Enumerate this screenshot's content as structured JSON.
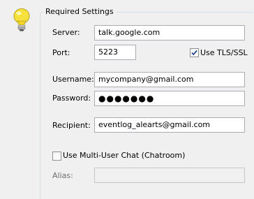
{
  "group": {
    "title": "Required Settings"
  },
  "fields": {
    "server": {
      "label": "Server:",
      "value": "talk.google.com"
    },
    "port": {
      "label": "Port:",
      "value": "5223"
    },
    "username": {
      "label": "Username:",
      "value": "mycompany@gmail.com"
    },
    "password": {
      "label": "Password:",
      "value": "●●●●●●●"
    },
    "recipient": {
      "label": "Recipient:",
      "value": "eventlog_alearts@gmail.com"
    },
    "alias": {
      "label": "Alias:",
      "value": ""
    }
  },
  "options": {
    "tls": {
      "label": "Use TLS/SSL",
      "checked": true
    },
    "multi_user_chat": {
      "label": "Use Multi-User Chat (Chatroom)",
      "checked": false
    }
  },
  "icons": {
    "header": "lightbulb-icon"
  },
  "colors": {
    "bulb": "#f7e13c",
    "checkmark": "#2b4d8c"
  }
}
